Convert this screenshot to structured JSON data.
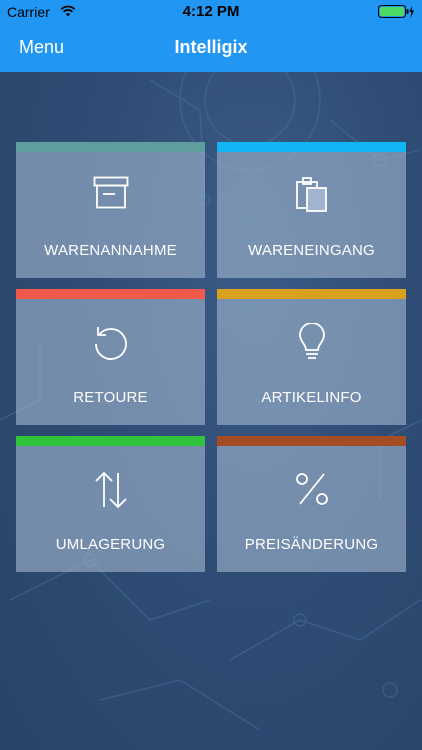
{
  "status_bar": {
    "carrier": "Carrier",
    "time": "4:12 PM"
  },
  "nav": {
    "menu_label": "Menu",
    "title": "Intelligix"
  },
  "colors": {
    "primary": "#2196f3",
    "background": "#2e4a72"
  },
  "tiles": [
    {
      "label": "WARENANNAHME",
      "icon": "archive-box-icon",
      "accent": "#5f9e9f"
    },
    {
      "label": "WARENEINGANG",
      "icon": "clipboard-icon",
      "accent": "#12b6f5"
    },
    {
      "label": "RETOURE",
      "icon": "undo-icon",
      "accent": "#f15a4a"
    },
    {
      "label": "ARTIKELINFO",
      "icon": "lightbulb-icon",
      "accent": "#d8a21f"
    },
    {
      "label": "UMLAGERUNG",
      "icon": "swap-arrows-icon",
      "accent": "#2fc43a"
    },
    {
      "label": "PREISÄNDERUNG",
      "icon": "percent-icon",
      "accent": "#a64c25"
    }
  ]
}
